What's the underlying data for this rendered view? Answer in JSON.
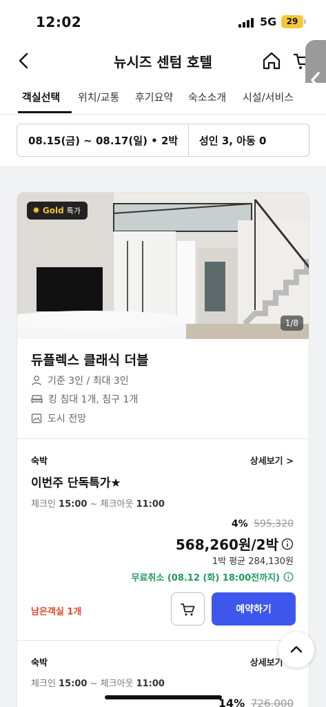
{
  "status_bar": {
    "time": "12:02",
    "network": "5G",
    "battery": "29"
  },
  "header": {
    "title": "뉴시즈 센텀 호텔"
  },
  "tabs": [
    {
      "label": "객실선택",
      "active": true
    },
    {
      "label": "위치/교통"
    },
    {
      "label": "후기요약"
    },
    {
      "label": "숙소소개"
    },
    {
      "label": "시설/서비스"
    }
  ],
  "search": {
    "dates": "08.15(금) ~ 08.17(일) • 2박",
    "guests": "성인 3, 아동 0"
  },
  "room": {
    "badge_gold": "Gold",
    "badge_deal": "특가",
    "photo_counter": "1/8",
    "name": "듀플렉스 클래식 더블",
    "capacity": "기준 3인 / 최대 3인",
    "beds": "킹 침대 1개, 침구 1개",
    "view": "도시 전망"
  },
  "plans": [
    {
      "type": "숙박",
      "detail_link": "상세보기 >",
      "name": "이번주 단독특가★",
      "checkin_label": "체크인",
      "checkin_time": "15:00",
      "separator": "~",
      "checkout_label": "체크아웃",
      "checkout_time": "11:00",
      "discount": "4%",
      "original_price": "595,320",
      "price": "568,260원/2박",
      "avg_price": "1박 평균 284,130원",
      "cancel": "무료취소 (08.12 (화) 18:00전까지)",
      "rooms_left": "남은객실 1개",
      "reserve_label": "예약하기"
    },
    {
      "type": "숙박",
      "detail_link": "상세보기 >",
      "checkin_label": "체크인",
      "checkin_time": "15:00",
      "separator": "~",
      "checkout_label": "체크아웃",
      "checkout_time": "11:00",
      "discount": "14%",
      "original_price": "726,000"
    }
  ],
  "colors": {
    "accent": "#3d57ec",
    "cancel_green": "#1f9a5c",
    "alert_red": "#e4472b",
    "badge_gold": "#f1c232",
    "battery": "#f5c63b"
  }
}
